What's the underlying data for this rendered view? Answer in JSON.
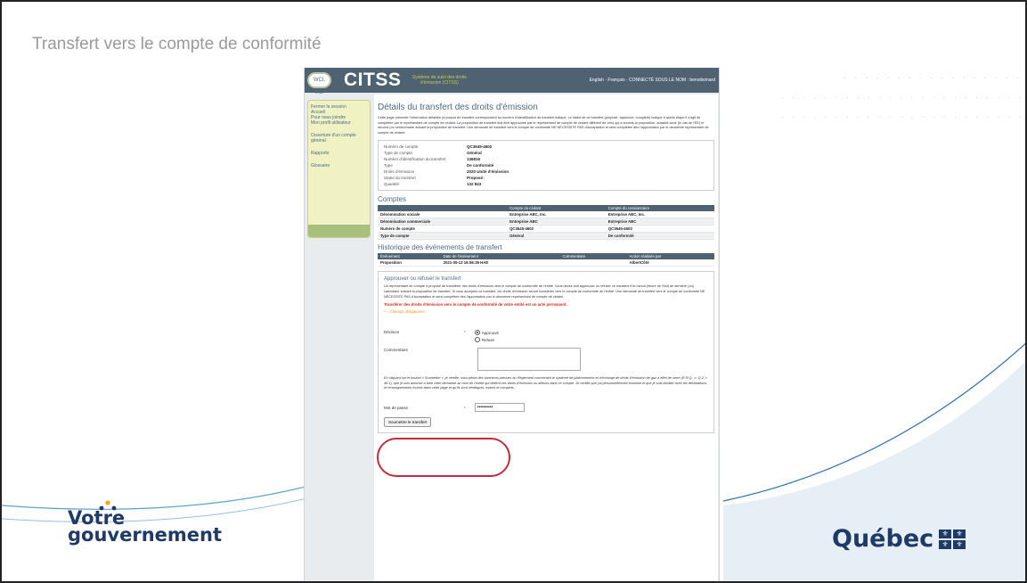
{
  "slide": {
    "title": "Transfert vers le compte de conformité",
    "logo_left": "Votre gouvernement",
    "logo_left_line1": "Votre",
    "logo_left_line2": "gouvernement",
    "logo_right": "Québec",
    "accent": "#1f3a66"
  },
  "app": {
    "logo": "WCI, Inc.",
    "title": "CITSS",
    "subtitle": "Système de suivi des droits d'émission (CITSS)",
    "header_links": "English · Français · CONNECTÉ SOUS LE NOM : benoitsimard"
  },
  "sidebar": {
    "items": [
      "Fermer la session",
      "Accueil",
      "Pour nous joindre",
      "Mon profil utilisateur",
      "Ouverture d'un compte général",
      "Rapports",
      "Glossaire"
    ]
  },
  "page": {
    "heading": "Détails du transfert des droits d'émission",
    "intro": "Cette page présente l'information détaillée (à propos de transfert correspondant au numéro d'identification de transfert indiqué. Le statut de ce transfert (proposé, approuvé, complété) indique à quelle étape il s'agit de complétée par le représentant de compte de cédant. La proposition de transfert doit être approuvée par le représentant de compte de cédant différent de celui qui a soumis la proposition, aussitôt avoir (le cas de l'EE) le second (ou cessionnaire avisant la proposition de transfert. Une demande de transfert vers le compte de conformité NE NÉCESSITE PAS d'acceptation et sera complétée dès l'approbation par le deuxième représentant de compte de cédant."
  },
  "details": [
    {
      "label": "Numéro de compte",
      "value": "QC3645-4602"
    },
    {
      "label": "Type de compte",
      "value": "Général"
    },
    {
      "label": "Numéro d'identification du transfert",
      "value": "136816"
    },
    {
      "label": "Type",
      "value": "De conformité"
    },
    {
      "label": "Droits d'émission",
      "value": "2020 Unité d'émission"
    },
    {
      "label": "Statut du transfert",
      "value": "Proposé"
    },
    {
      "label": "Quantité",
      "value": "132 843"
    }
  ],
  "comptes": {
    "title": "Comptes",
    "headers": [
      "",
      "Compte du cédant",
      "Compte du cessionnaire"
    ],
    "rows": [
      [
        "Dénomination sociale",
        "Entreprise ABC, Inc.",
        "Entreprise ABC, Inc."
      ],
      [
        "Dénomination commerciale",
        "Entreprise ABC",
        "Entreprise ABC"
      ],
      [
        "Numéro de compte",
        "QC3645-4602",
        "QC3645-4603"
      ],
      [
        "Type de compte",
        "Général",
        "De conformité"
      ]
    ]
  },
  "historique": {
    "title": "Historique des événements de transfert",
    "headers": [
      "Événement",
      "Date de l'événement",
      "Commentaire",
      "Action réalisée par"
    ],
    "rows": [
      [
        "Proposition",
        "2021-05-12 16:56:39 HAE",
        "",
        "AlbertCôté"
      ]
    ]
  },
  "approve": {
    "title": "Approuver ou refuser le transfert",
    "text": "Un représentant de compte a proposé de transférer des droits d'émission vers le compte de conformité de l'entité. Vous devez soit approuver ou refuser ce transfert d'ici minuit (heure de l'est) de dernière (ou) calendaire suivant la proposition de transfert. Si vous acceptez ce transfert, les droits d'émission seront transférés vers le compte de conformité de l'entité. Une demande de transfert vers le compte de conformité NE NÉCESSITE PAS d'acceptation et sera complétée dès l'approbation par le deuxième représentant de compte de cédant.",
    "warning": "Transférer des droits d'émission vers le compte de conformité de votre entité est un acte permanent.",
    "required": "* = Champs obligatoires",
    "decision_label": "Décision",
    "option_approve": "Approuvé",
    "option_refuse": "Refusé",
    "comment_label": "Commentaire",
    "attestation": "En cliquant sur le bouton « Soumettre », je certifie, sous peine des sanctions prévues au Règlement concernant le système de plafonnement et d'échange de droits d'émission de gaz à effet de serre (R.R.Q., c. Q-2, r. 46.1), que je suis autorisé à faire cette demande au nom de l'entité qui détient ces droits d'émission ou ailleurs dans ce compte. Je certifie que j'ai personnellement examiné et que je suis familier avec les déclarations et renseignements fournis dans cette page et qu'ils sont véridiques, exacts et complets.",
    "password_label": "Mot de passe",
    "password_value": "••••••••••",
    "submit": "Soumettre le transfert"
  }
}
